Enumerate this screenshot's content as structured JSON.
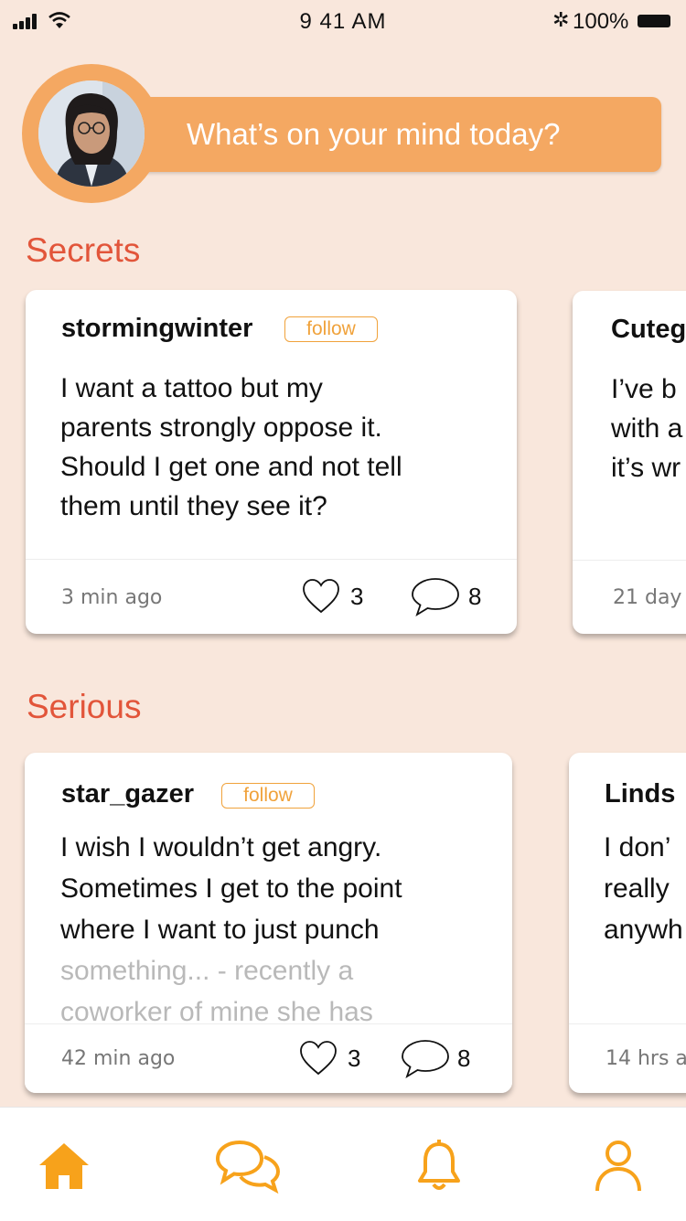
{
  "status_bar": {
    "time": "9 41 AM",
    "battery": "100%",
    "bluetooth": "bluetooth-icon"
  },
  "compose": {
    "placeholder": "What’s on your mind today?"
  },
  "sections": [
    {
      "title": "Secrets",
      "cards": [
        {
          "username": "stormingwinter",
          "follow_label": "follow",
          "lines": [
            "I want a tattoo but my",
            "parents strongly oppose it.",
            "Should I get one and not tell",
            "them until they see it?"
          ],
          "time": "3 min ago",
          "likes": "3",
          "comments": "8"
        },
        {
          "username": "Cuteg",
          "lines": [
            "I’ve b",
            "with a",
            "it’s wr"
          ],
          "time": "21 day"
        }
      ]
    },
    {
      "title": "Serious",
      "cards": [
        {
          "username": "star_gazer",
          "follow_label": "follow",
          "lines": [
            "I wish I wouldn’t get angry.",
            "Sometimes I get to the point",
            "where I want to just punch"
          ],
          "faded_lines": [
            "something... - recently a",
            "coworker of mine she has"
          ],
          "time": "42 min ago",
          "likes": "3",
          "comments": "8"
        },
        {
          "username": "Linds",
          "lines": [
            "I don’",
            "really",
            "anywh"
          ],
          "time": "14 hrs a"
        }
      ]
    }
  ],
  "tab_bar": [
    "home-icon",
    "chat-icon",
    "bell-icon",
    "profile-icon"
  ],
  "colors": {
    "accent": "#f4a862",
    "section_title": "#e2553a",
    "tab_icon": "#f7a21b",
    "background": "#f9e7dc"
  }
}
